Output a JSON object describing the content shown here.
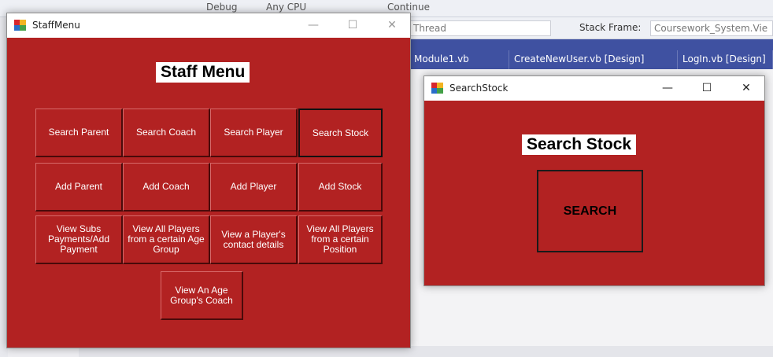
{
  "ide": {
    "toolbar_items": [
      "Debug",
      "Any CPU",
      "Continue"
    ],
    "debug": {
      "thread_label": "Thread",
      "stack_frame_label": "Stack Frame:",
      "stack_frame_value": "Coursework_System.Vie"
    },
    "tabs": [
      "Module1.vb",
      "CreateNewUser.vb [Design]",
      "LogIn.vb [Design]"
    ]
  },
  "staff_window": {
    "title": "StaffMenu",
    "heading": "Staff Menu",
    "controls": {
      "minimize": "—",
      "maximize": "☐",
      "close": "✕"
    },
    "buttons": [
      "Search Parent",
      "Search Coach",
      "Search Player",
      "Search Stock",
      "Add Parent",
      "Add Coach",
      "Add Player",
      "Add Stock",
      "View Subs Payments/Add Payment",
      "View All Players from a certain Age Group",
      "View a Player's contact details",
      "View All Players from a certain Position",
      "View An Age Group's Coach"
    ]
  },
  "search_window": {
    "title": "SearchStock",
    "heading": "Search Stock",
    "controls": {
      "minimize": "—",
      "maximize": "☐",
      "close": "✕"
    },
    "search_button": "SEARCH"
  },
  "colors": {
    "form_background": "#b22222",
    "ide_tab_bar": "#3f51a1"
  }
}
